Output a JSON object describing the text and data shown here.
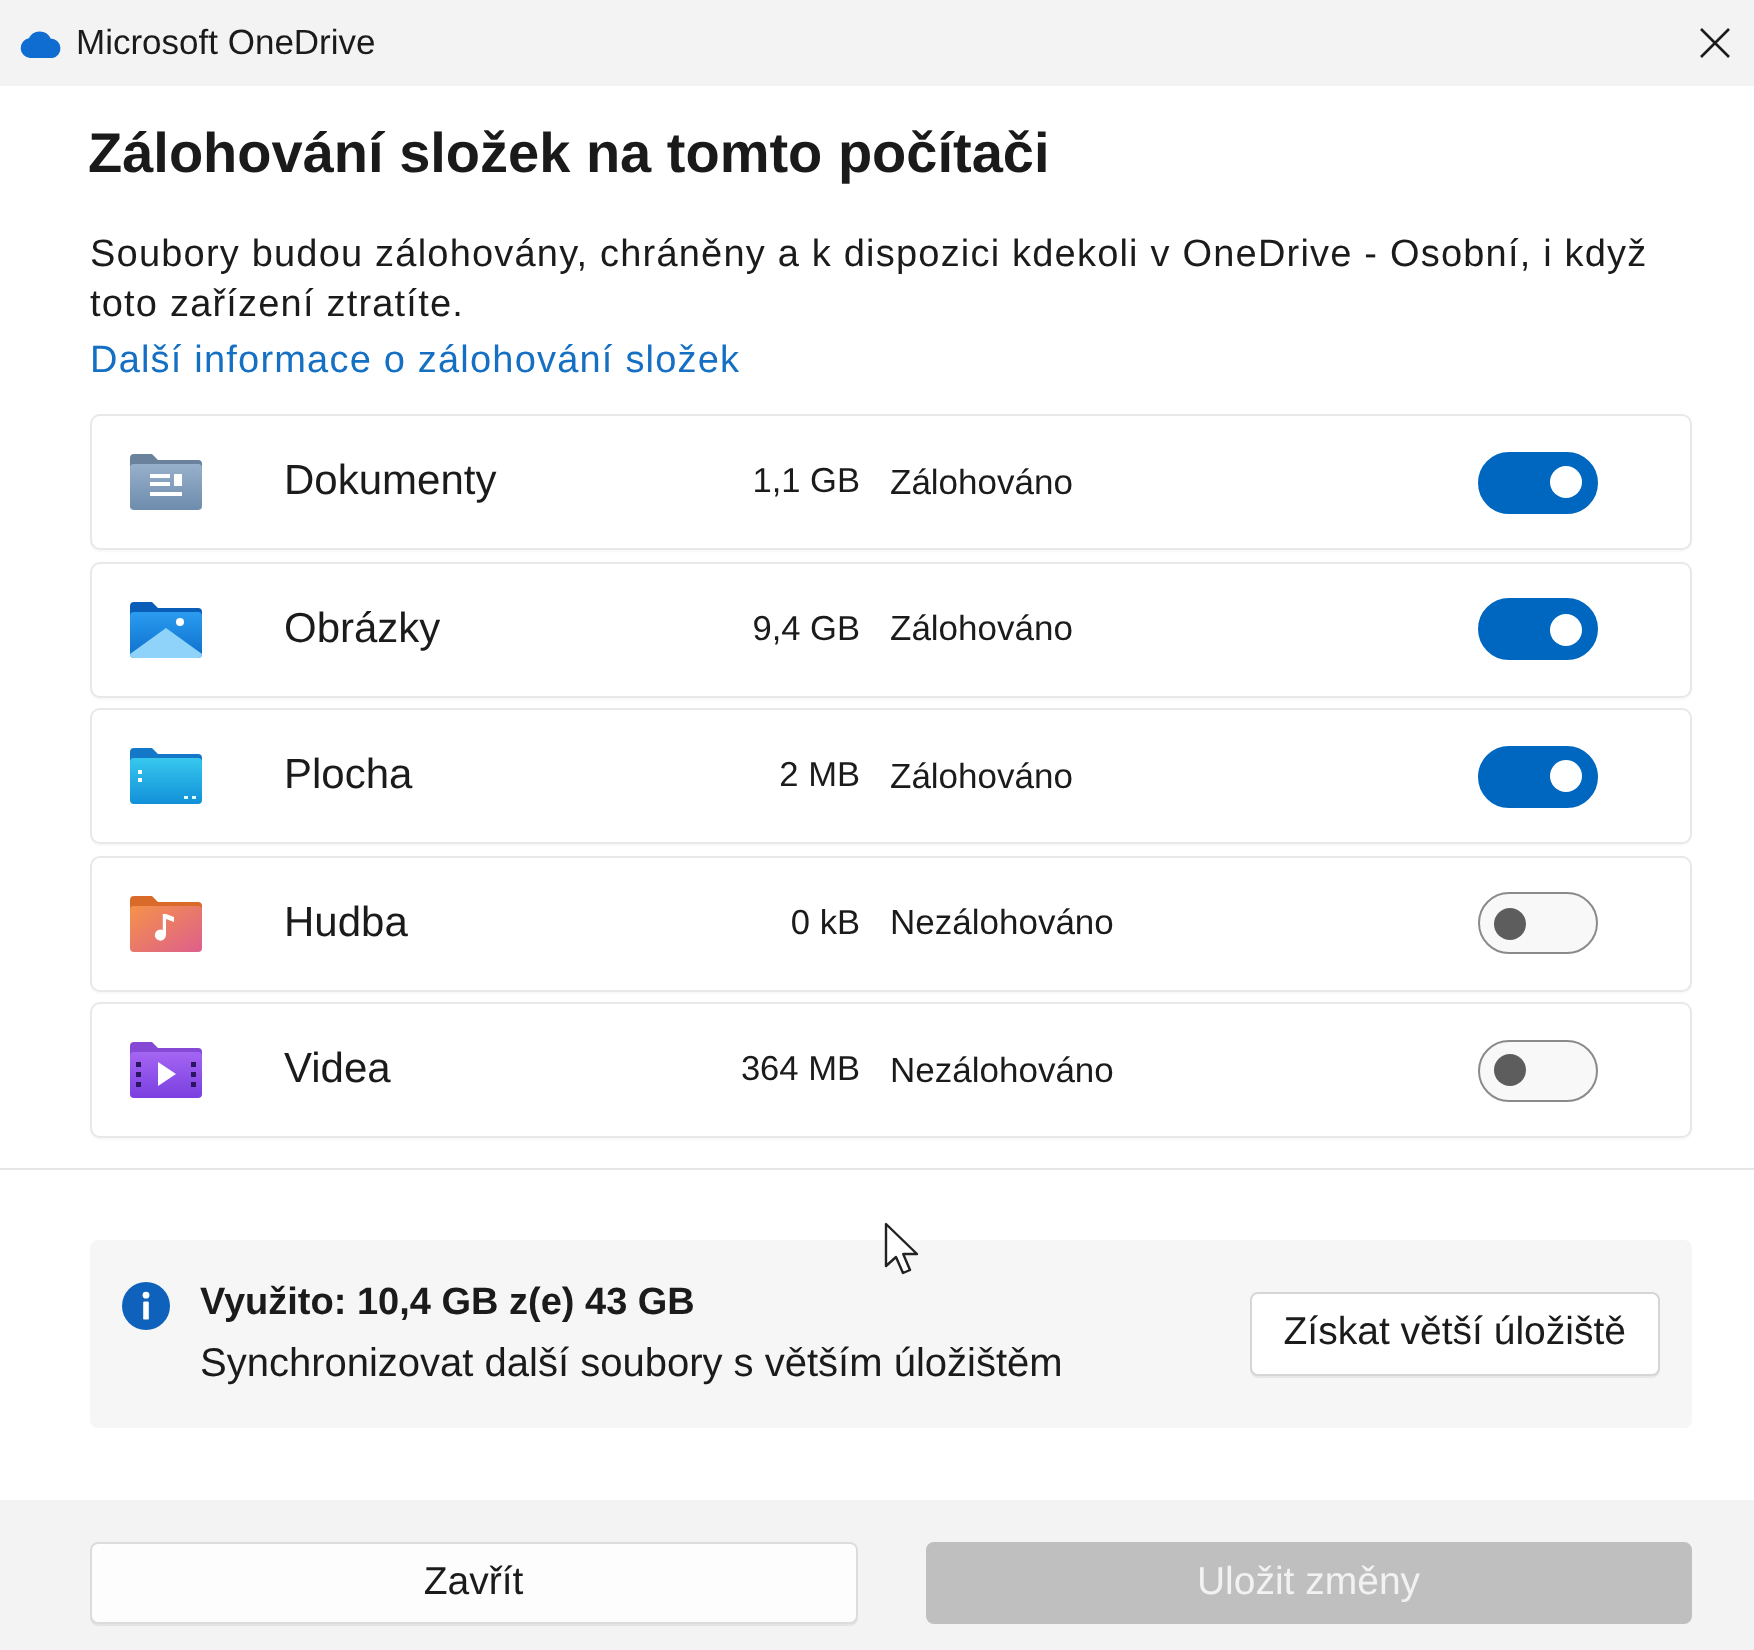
{
  "window": {
    "title": "Microsoft OneDrive"
  },
  "heading": "Zálohování složek na tomto počítači",
  "description": "Soubory budou zálohovány, chráněny a k dispozici kdekoli v OneDrive - Osobní, i když toto zařízení ztratíte.",
  "learn_more_link": "Další informace o zálohování složek",
  "folders": [
    {
      "kind": "documents",
      "name": "Dokumenty",
      "size": "1,1 GB",
      "status": "Zálohováno",
      "on": true
    },
    {
      "kind": "pictures",
      "name": "Obrázky",
      "size": "9,4 GB",
      "status": "Zálohováno",
      "on": true
    },
    {
      "kind": "desktop",
      "name": "Plocha",
      "size": "2 MB",
      "status": "Zálohováno",
      "on": true
    },
    {
      "kind": "music",
      "name": "Hudba",
      "size": "0 kB",
      "status": "Nezálohováno",
      "on": false
    },
    {
      "kind": "videos",
      "name": "Videa",
      "size": "364 MB",
      "status": "Nezálohováno",
      "on": false
    }
  ],
  "storage": {
    "usage": "Využito: 10,4 GB z(e) 43 GB",
    "message": "Synchronizovat další soubory s větším úložištěm",
    "button": "Získat větší úložiště"
  },
  "buttons": [
    {
      "label": "Zavřít",
      "disabled": false
    },
    {
      "label": "Uložit změny",
      "disabled": true
    }
  ]
}
